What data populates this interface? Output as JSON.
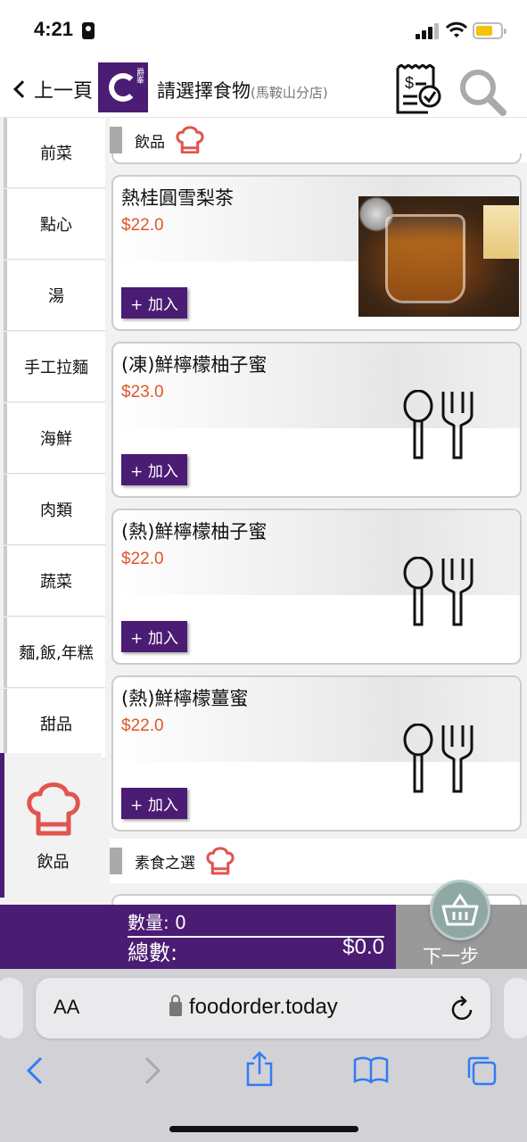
{
  "status_bar": {
    "time": "4:21"
  },
  "header": {
    "back_label": "上一頁",
    "logo_text": "爵峯",
    "title": "請選擇食物",
    "subtitle": "(馬鞍山分店)"
  },
  "sidebar": {
    "items": [
      {
        "label": "前菜"
      },
      {
        "label": "點心"
      },
      {
        "label": "湯"
      },
      {
        "label": "手工拉麵"
      },
      {
        "label": "海鮮"
      },
      {
        "label": "肉類"
      },
      {
        "label": "蔬菜"
      },
      {
        "label": "麵,飯,年糕"
      },
      {
        "label": "甜品"
      },
      {
        "label": "飲品"
      }
    ],
    "active": "飲品"
  },
  "sections": [
    {
      "label": "飲品"
    },
    {
      "label": "素食之選"
    }
  ],
  "items": [
    {
      "name": "熱桂圓雪梨茶",
      "price": "$22.0",
      "add_label": "+ 加入",
      "has_photo": true
    },
    {
      "name": "(凍)鮮檸檬柚子蜜",
      "price": "$23.0",
      "add_label": "+ 加入",
      "has_photo": false
    },
    {
      "name": "(熱)鮮檸檬柚子蜜",
      "price": "$22.0",
      "add_label": "+ 加入",
      "has_photo": false
    },
    {
      "name": "(熱)鮮檸檬薑蜜",
      "price": "$22.0",
      "add_label": "+ 加入",
      "has_photo": false
    }
  ],
  "cart": {
    "qty_label": "數量: 0",
    "total_label": "總數:",
    "total_value": "$0.0",
    "next_label": "下一步"
  },
  "browser": {
    "aa_label": "AA",
    "url": "foodorder.today"
  },
  "colors": {
    "brand": "#4b1c73",
    "price": "#e0552a",
    "chef_icon": "#e0554f",
    "safari_blue": "#2f7cf6"
  }
}
